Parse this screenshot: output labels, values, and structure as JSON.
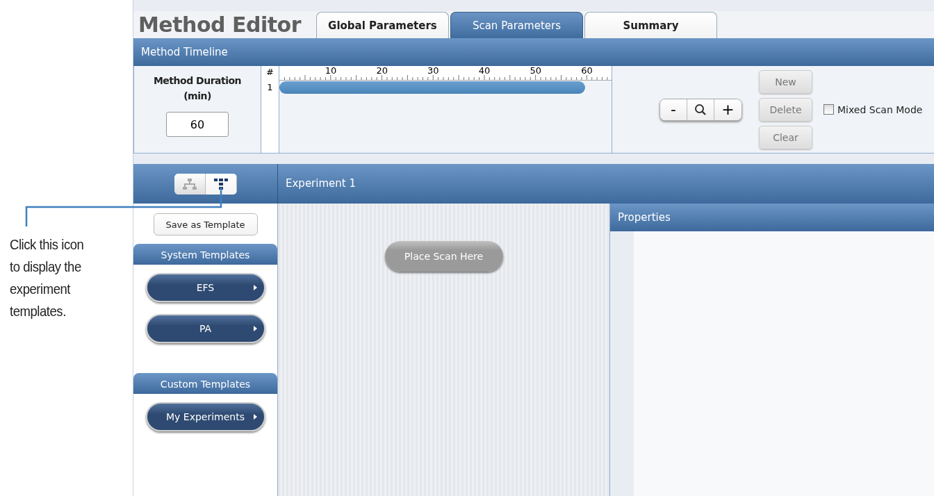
{
  "callout": {
    "text": "Click this icon to display the experiment templates."
  },
  "title": "Method Editor",
  "tabs": [
    {
      "label": "Global Parameters",
      "selected": false
    },
    {
      "label": "Scan Parameters",
      "selected": true
    },
    {
      "label": "Summary",
      "selected": false
    }
  ],
  "timeline": {
    "header": "Method Timeline",
    "duration_label": "Method Duration (min)",
    "duration_value": "60",
    "row_header": "#",
    "ruler_labels": [
      "10",
      "20",
      "30",
      "40",
      "50",
      "60"
    ],
    "rows": [
      {
        "number": "1",
        "level": 0.92
      }
    ],
    "zoom_buttons": [
      "-",
      "+"
    ],
    "buttons": [
      "New",
      "Delete",
      "Clear"
    ],
    "mixed_scan_mode": {
      "label": "Mixed Scan Mode",
      "checked": false
    }
  },
  "view_toggle": [
    {
      "kind": "tree",
      "selected": false
    },
    {
      "kind": "template",
      "selected": true
    }
  ],
  "experiment": {
    "title": "Experiment 1",
    "placeholder_button": "Place Scan Here"
  },
  "sidebar": {
    "save_button": "Save as Template",
    "sections": [
      {
        "title": "System Templates",
        "items": [
          "EFS",
          "PA"
        ]
      },
      {
        "title": "Custom Templates",
        "items": [
          "My Experiments"
        ]
      }
    ]
  },
  "properties": {
    "title": "Properties"
  }
}
